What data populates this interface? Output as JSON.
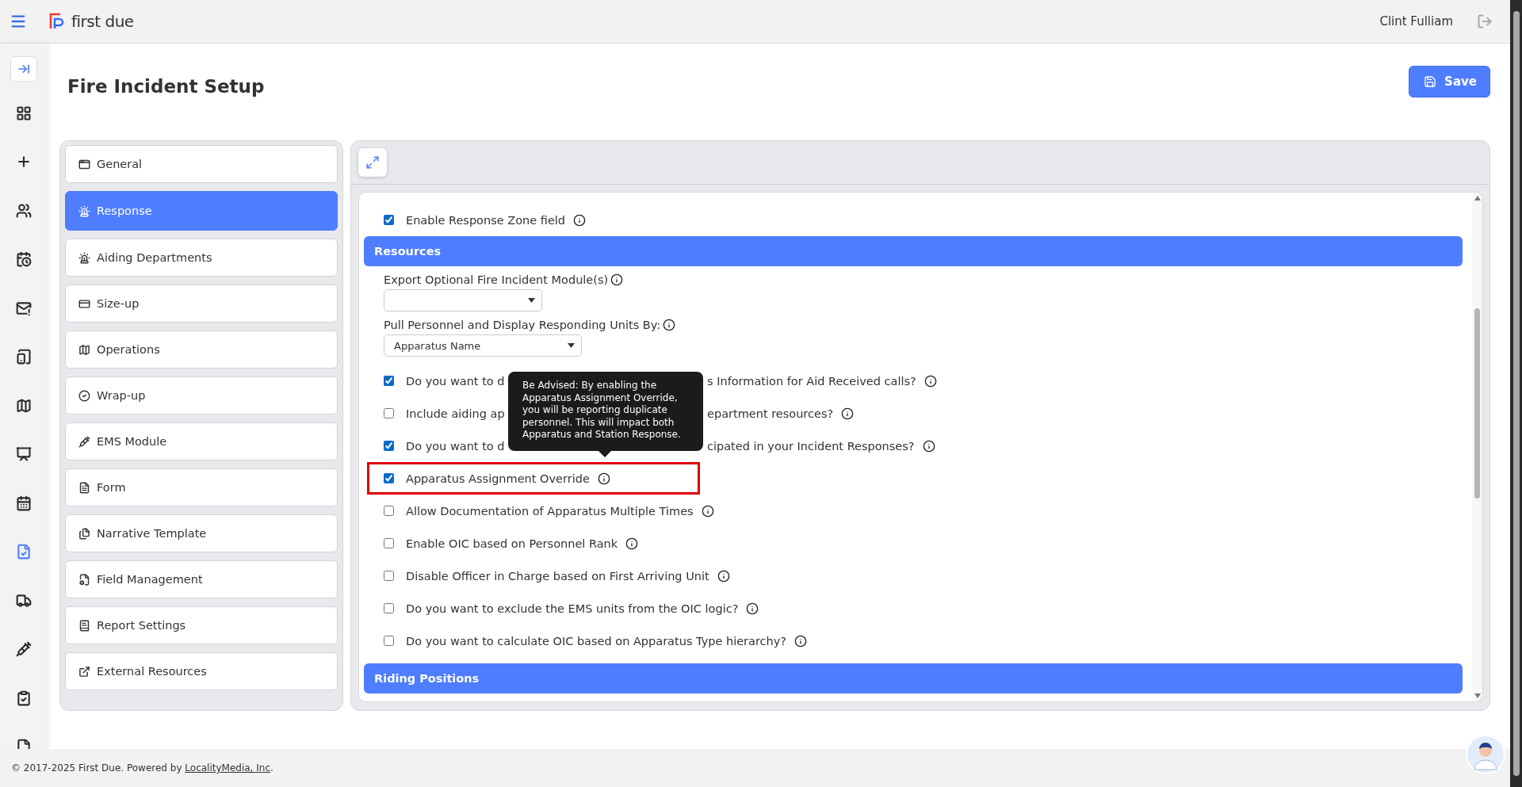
{
  "header": {
    "brand": "first due",
    "user": "Clint Fulliam"
  },
  "rail": [
    {
      "selected": true
    },
    {
      "selected": false
    },
    {
      "selected": false
    },
    {
      "selected": false
    },
    {
      "selected": false
    },
    {
      "selected": false
    },
    {
      "selected": false
    },
    {
      "selected": false
    },
    {
      "selected": false
    },
    {
      "selected": false
    },
    {
      "selected": true
    },
    {
      "selected": false
    },
    {
      "selected": false
    },
    {
      "selected": false
    },
    {
      "selected": false
    }
  ],
  "page": {
    "title": "Fire Incident Setup",
    "save_button": "Save"
  },
  "menu": [
    {
      "label": "General",
      "selected": false
    },
    {
      "label": "Response",
      "selected": true
    },
    {
      "label": "Aiding Departments",
      "selected": false
    },
    {
      "label": "Size-up",
      "selected": false
    },
    {
      "label": "Operations",
      "selected": false
    },
    {
      "label": "Wrap-up",
      "selected": false
    },
    {
      "label": "EMS Module",
      "selected": false
    },
    {
      "label": "Form",
      "selected": false
    },
    {
      "label": "Narrative Template",
      "selected": false
    },
    {
      "label": "Field Management",
      "selected": false
    },
    {
      "label": "Report Settings",
      "selected": false
    },
    {
      "label": "External Resources",
      "selected": false
    }
  ],
  "settings": {
    "top_row": {
      "label": "Enable Response Zone field",
      "checked": true
    },
    "resources_heading": "Resources",
    "export_label": "Export Optional Fire Incident Module(s)",
    "pull_label": "Pull Personnel and Display Responding Units By:",
    "pull_value": "Apparatus Name",
    "rows": [
      {
        "label_before": "Do you want to d",
        "label_after": "s Information for Aid Received calls?",
        "checked": true,
        "highlighted": false
      },
      {
        "label_before": "Include aiding ap",
        "label_after": "epartment resources?",
        "checked": false,
        "highlighted": false
      },
      {
        "label_before": "Do you want to d",
        "label_after": "cipated in your Incident Responses?",
        "checked": true,
        "highlighted": false
      },
      {
        "label": "Apparatus Assignment Override",
        "checked": true,
        "highlighted": true
      },
      {
        "label": "Allow Documentation of Apparatus Multiple Times",
        "checked": false,
        "highlighted": false
      },
      {
        "label": "Enable OIC based on Personnel Rank",
        "checked": false,
        "highlighted": false
      },
      {
        "label": "Disable Officer in Charge based on First Arriving Unit",
        "checked": false,
        "highlighted": false
      },
      {
        "label": "Do you want to exclude the EMS units from the OIC logic?",
        "checked": false,
        "highlighted": false
      },
      {
        "label": "Do you want to calculate OIC based on Apparatus Type hierarchy?",
        "checked": false,
        "highlighted": false
      }
    ],
    "riding_heading": "Riding Positions",
    "tooltip": "Be Advised: By enabling the Apparatus Assignment Override, you will be reporting duplicate personnel. This will impact both Apparatus and Station Response."
  },
  "footer": {
    "text_before": "© 2017-2025 First Due. Powered by ",
    "link": "LocalityMedia, Inc",
    "text_after": "."
  }
}
